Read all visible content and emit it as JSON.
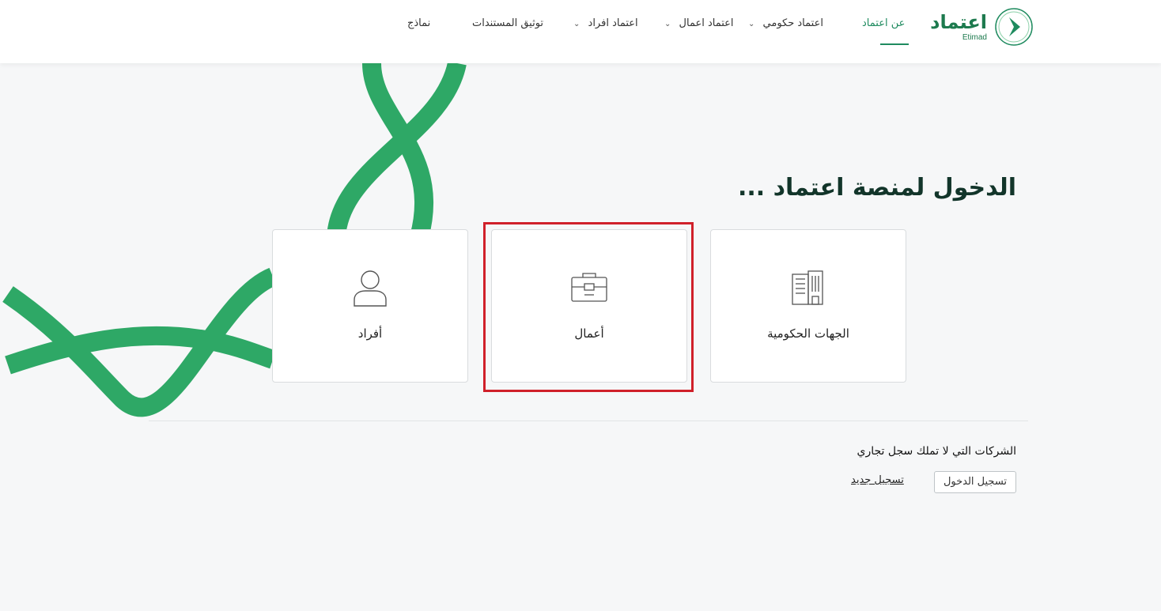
{
  "header": {
    "logo_text": "اعتماد",
    "logo_sub": "Etimad",
    "nav": [
      {
        "label": "عن اعتماد",
        "active": true
      },
      {
        "label": "اعتماد حكومي",
        "chevron": true
      },
      {
        "label": "اعتماد اعمال",
        "chevron": true
      },
      {
        "label": "اعتماد افراد",
        "chevron": true
      },
      {
        "label": "توثيق المستندات"
      },
      {
        "label": "نماذج"
      }
    ],
    "chevron_glyph": "⌄"
  },
  "main": {
    "title": "الدخول لمنصة اعتماد ...",
    "cards": [
      {
        "label": "الجهات الحكومية",
        "icon": "building-icon"
      },
      {
        "label": "أعمال",
        "icon": "briefcase-icon"
      },
      {
        "label": "أفراد",
        "icon": "user-icon"
      }
    ],
    "note": "الشركات التي لا تملك سجل تجاري",
    "login_label": "تسجيل الدخول",
    "register_label": "تسجيل جديد"
  },
  "colors": {
    "brand": "#1f8b5f",
    "ribbon": "#2ea866",
    "highlight": "#d0202a"
  }
}
